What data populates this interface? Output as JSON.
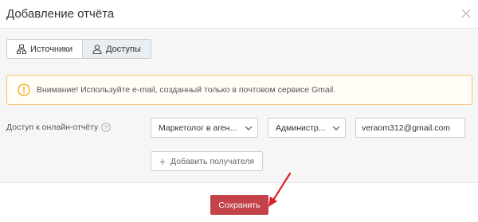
{
  "dialog": {
    "title": "Добавление отчёта"
  },
  "tabs": [
    {
      "label": "Источники"
    },
    {
      "label": "Доступы"
    }
  ],
  "warning": {
    "text": "Внимание! Используйте e-mail, созданный только в почтовом сервисе Gmail."
  },
  "access": {
    "label": "Доступ к онлайн-отчёту",
    "role_select": "Маркетолог в аген...",
    "permission_select": "Администр...",
    "email_value": "veraom312@gmail.com"
  },
  "add_recipient": {
    "label": "Добавить получателя"
  },
  "footer": {
    "save_label": "Сохранить"
  },
  "colors": {
    "save_button": "#c4424a",
    "warning_border": "#f0c36d",
    "annotation_arrow": "#e0212a"
  },
  "icons": {
    "close": "close-icon",
    "sources_tab": "network-icon",
    "access_tab": "user-icon",
    "warning": "exclamation-circle-icon",
    "help": "question-circle-icon",
    "dropdown": "chevron-down-icon",
    "add": "plus-icon"
  }
}
